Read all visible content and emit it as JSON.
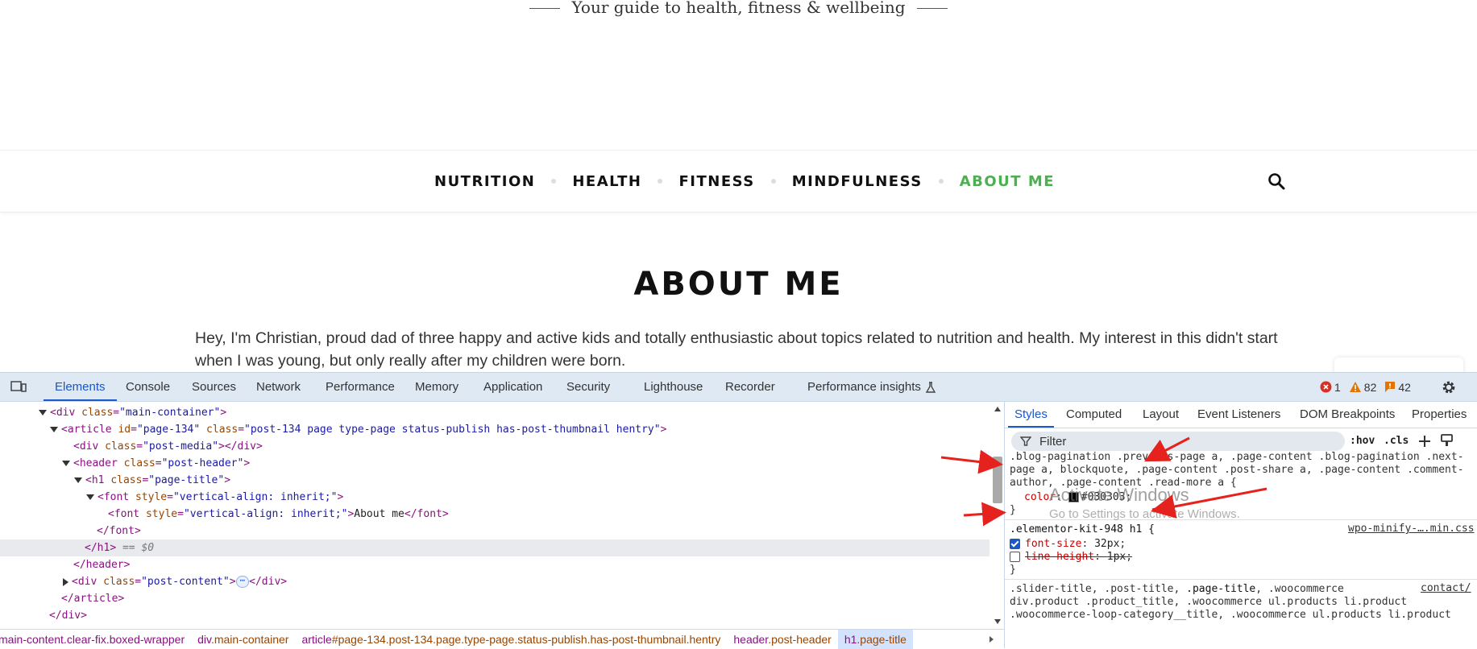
{
  "site": {
    "tagline": "Your guide to health, fitness & wellbeing",
    "nav": [
      "NUTRITION",
      "HEALTH",
      "FITNESS",
      "MINDFULNESS",
      "ABOUT ME"
    ],
    "active_nav": "ABOUT ME",
    "page_title": "ABOUT ME",
    "intro": "Hey, I'm Christian, proud dad of three happy and active kids and totally enthusiastic about topics related to nutrition and health. My interest in this didn't start when I was young, but only really after my children were born.",
    "accent_color": "#4caf50"
  },
  "devtools": {
    "tabs": [
      "Elements",
      "Console",
      "Sources",
      "Network",
      "Performance",
      "Memory",
      "Application",
      "Security",
      "Lighthouse",
      "Recorder",
      "Performance insights"
    ],
    "active_tab": "Elements",
    "errors": "1",
    "warnings": "82",
    "issues": "42",
    "dom": {
      "l1_tag": "div",
      "l1_attr": "class",
      "l1_val": "\"main-container\"",
      "l2_tag": "article",
      "l2_attr1": "id",
      "l2_val1": "\"page-134\"",
      "l2_attr2": "class",
      "l2_val2": "\"post-134 page type-page status-publish has-post-thumbnail hentry\"",
      "l3_tag": "div",
      "l3_attr": "class",
      "l3_val": "\"post-media\"",
      "l4_tag": "header",
      "l4_attr": "class",
      "l4_val": "\"post-header\"",
      "l5_tag": "h1",
      "l5_attr": "class",
      "l5_val": "\"page-title\"",
      "l6_tag": "font",
      "l6_attr": "style",
      "l6_val": "\"vertical-align: inherit;\"",
      "l7_tag": "font",
      "l7_attr": "style",
      "l7_val": "\"vertical-align: inherit;\"",
      "l7_text": "About me",
      "selected_marker": "== $0",
      "post_content_class": "\"post-content\"",
      "ellipsis": "⋯"
    },
    "breadcrumb": [
      {
        "tag": "main-content.clear-fix.boxed-wrapper",
        "rest": ""
      },
      {
        "tag": "div",
        "rest": ".main-container"
      },
      {
        "tag": "article",
        "rest": "#page-134.post-134.page.type-page.status-publish.has-post-thumbnail.hentry"
      },
      {
        "tag": "header",
        "rest": ".post-header"
      },
      {
        "tag": "h1",
        "rest": ".page-title"
      }
    ],
    "styles_tabs": [
      "Styles",
      "Computed",
      "Layout",
      "Event Listeners",
      "DOM Breakpoints",
      "Properties"
    ],
    "filter_placeholder": "Filter",
    "hov_label": ":hov",
    "cls_label": ".cls",
    "rules": {
      "r1_line1": ".blog-pagination .previous-page a, .page-content .blog-pagination .next-",
      "r1_line2": "page a, blockquote, .page-content .post-share a, .page-content .comment-",
      "r1_line3": "author, .page-content .read-more a {",
      "r1_prop": "color",
      "r1_val": "#030303",
      "r2_selector": ".elementor-kit-948 h1 {",
      "r2_source": "wpo-minify-….min.css",
      "r2_prop1": "font-size",
      "r2_val1": "32px",
      "r2_prop2": "line-height",
      "r2_val2": "1px",
      "r3_line1": ".slider-title, .post-title, ",
      "r3_line1b": ".page-title",
      "r3_line1c": ", .woocommerce",
      "r3_source": "contact/",
      "r3_line2": "div.product .product_title, .woocommerce ul.products li.product",
      "r3_line3": ".woocommerce-loop-category__title, .woocommerce ul.products li.product"
    },
    "watermark_title": "Activate Windows",
    "watermark_sub": "Go to Settings to activate Windows."
  }
}
